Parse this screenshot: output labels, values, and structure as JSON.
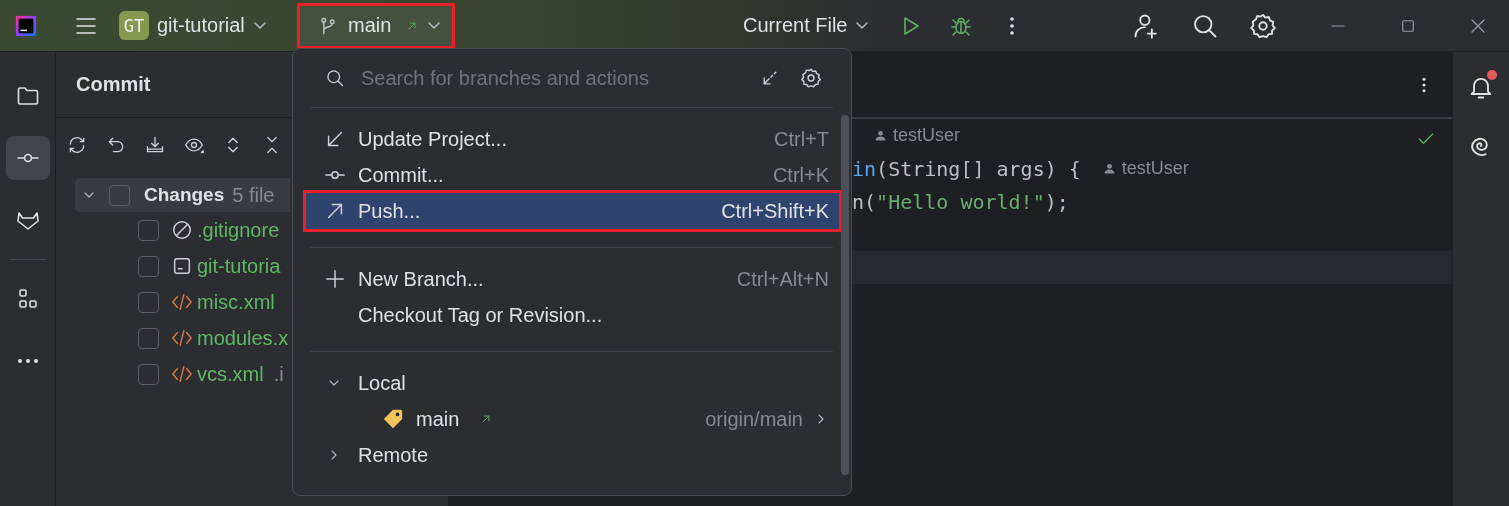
{
  "title_bar": {
    "project": {
      "badge": "GT",
      "name": "git-tutorial"
    },
    "branch": {
      "name": "main",
      "outgoing": true,
      "highlighted": true
    },
    "run_config": "Current File"
  },
  "tool_strip": [
    {
      "kind": "folder",
      "selected": false
    },
    {
      "kind": "commit",
      "selected": true
    },
    {
      "kind": "gitlab",
      "selected": false
    },
    {
      "kind": "structure",
      "selected": false
    },
    {
      "kind": "more",
      "selected": false
    }
  ],
  "commit_panel": {
    "title": "Commit",
    "changes": {
      "label": "Changes",
      "count": "5 file",
      "expanded": true,
      "checked": false
    },
    "files": [
      {
        "name": ".gitignore",
        "kind": "ignored",
        "checked": false
      },
      {
        "name": "git-tutoria",
        "kind": "module",
        "checked": false
      },
      {
        "name": "misc.xml",
        "kind": "xml",
        "checked": false
      },
      {
        "name": "modules.x",
        "kind": "xml",
        "checked": false
      },
      {
        "name": "vcs.xml",
        "path": ".i",
        "kind": "xml",
        "checked": false
      }
    ]
  },
  "editor": {
    "inspection_ok": true,
    "current_line": true,
    "lines": [
      {
        "author": "testUser"
      },
      {
        "tokens": [
          {
            "text": "in",
            "kind": "method"
          },
          {
            "text": "(String[] args) {",
            "kind": "plain"
          }
        ],
        "author": "testUser"
      },
      {
        "tokens": [
          {
            "text": "n(",
            "kind": "plain"
          },
          {
            "text": "\"Hello world!\"",
            "kind": "string"
          },
          {
            "text": ");",
            "kind": "plain"
          }
        ]
      }
    ]
  },
  "right_strip": {
    "notifications_unread": true
  },
  "branch_popup": {
    "search_placeholder": "Search for branches and actions",
    "action_groups": [
      [
        {
          "kind": "update",
          "label": "Update Project...",
          "shortcut": "Ctrl+T",
          "selected": false,
          "highlighted": false
        },
        {
          "kind": "commit",
          "label": "Commit...",
          "shortcut": "Ctrl+K",
          "selected": false,
          "highlighted": false
        },
        {
          "kind": "push",
          "label": "Push...",
          "shortcut": "Ctrl+Shift+K",
          "selected": true,
          "highlighted": true
        }
      ],
      [
        {
          "kind": "new_branch",
          "label": "New Branch...",
          "shortcut": "Ctrl+Alt+N",
          "selected": false,
          "highlighted": false
        },
        {
          "kind": "checkout",
          "label": "Checkout Tag or Revision...",
          "selected": false,
          "highlighted": false
        }
      ]
    ],
    "branch_groups": [
      {
        "label": "Local",
        "expanded": true,
        "children": [
          {
            "name": "main",
            "outgoing": true,
            "tracking": "origin/main"
          }
        ]
      },
      {
        "label": "Remote",
        "expanded": false
      }
    ]
  }
}
